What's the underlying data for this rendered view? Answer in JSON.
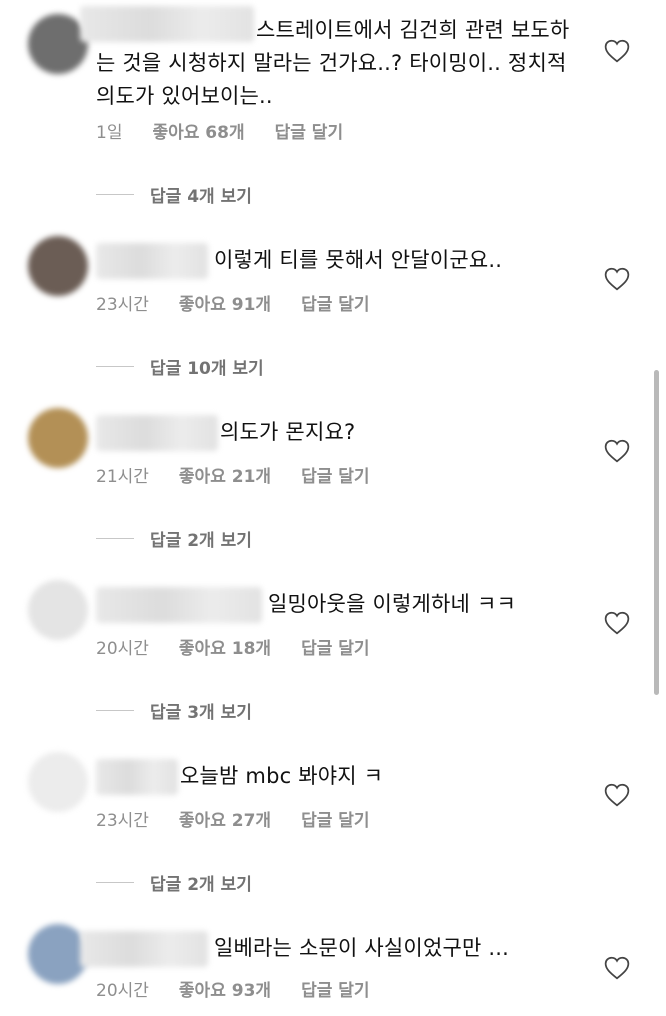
{
  "comments": [
    {
      "text": "스트레이트에서 김건희 관련 보도하는 것을 시청하지 말라는 건가요..? 타이밍이.. 정치적 의도가 있어보이는..",
      "time": "1일",
      "likes": "좋아요 68개",
      "reply": "답글 달기",
      "view_replies": "답글 4개 보기",
      "avatar_color": "#6e6e6e"
    },
    {
      "text": "이렇게 티를 못해서 안달이군요..",
      "time": "23시간",
      "likes": "좋아요 91개",
      "reply": "답글 달기",
      "view_replies": "답글 10개 보기",
      "avatar_color": "#6b5d55"
    },
    {
      "text": "의도가 몬지요?",
      "time": "21시간",
      "likes": "좋아요 21개",
      "reply": "답글 달기",
      "view_replies": "답글 2개 보기",
      "avatar_color": "#b39056"
    },
    {
      "text": "일밍아웃을 이렇게하네 ㅋㅋ",
      "time": "20시간",
      "likes": "좋아요 18개",
      "reply": "답글 달기",
      "view_replies": "답글 3개 보기",
      "avatar_color": "#e4e4e4"
    },
    {
      "text": "오늘밤 mbc 봐야지 ㅋ",
      "time": "23시간",
      "likes": "좋아요 27개",
      "reply": "답글 달기",
      "view_replies": "답글 2개 보기",
      "avatar_color": "#ececec"
    },
    {
      "text": "일베라는 소문이 사실이었구만 ...",
      "time": "20시간",
      "likes": "좋아요 93개",
      "reply": "답글 달기",
      "avatar_color": "#8aa2c0"
    }
  ],
  "icons": {
    "like": "heart-outline-icon"
  },
  "colors": {
    "meta": "#8e8e8e",
    "text": "#111111"
  }
}
